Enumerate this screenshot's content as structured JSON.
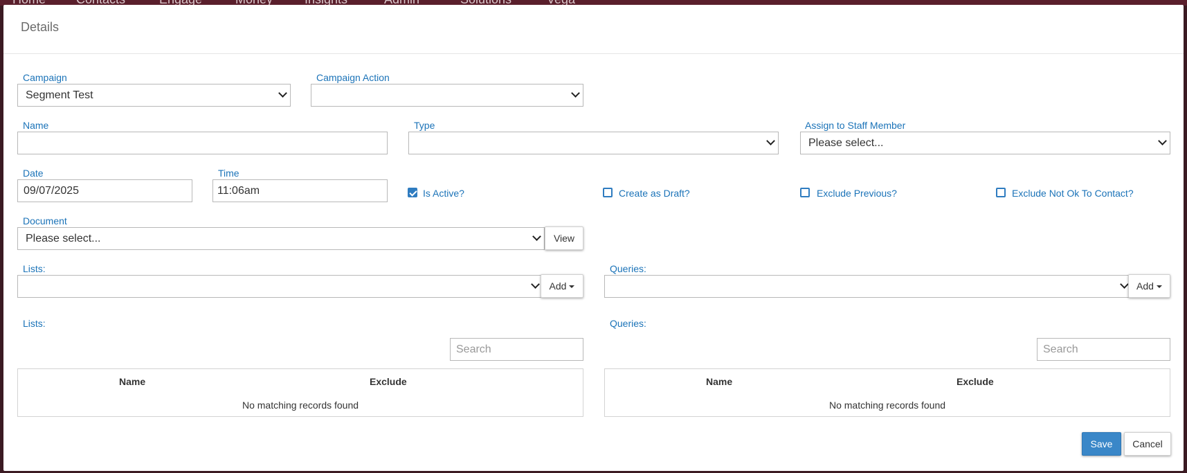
{
  "background_nav": [
    "Home",
    "Contacts",
    "Engage",
    "Money",
    "Insights",
    "Admin",
    "Solutions",
    "Vega"
  ],
  "modal": {
    "title": "Details",
    "campaign": {
      "label": "Campaign",
      "value": "Segment Test"
    },
    "campaign_action": {
      "label": "Campaign Action",
      "value": ""
    },
    "name": {
      "label": "Name",
      "value": ""
    },
    "type": {
      "label": "Type",
      "value": ""
    },
    "assign": {
      "label": "Assign to Staff Member",
      "value": "Please select..."
    },
    "date": {
      "label": "Date",
      "value": "09/07/2025"
    },
    "time": {
      "label": "Time",
      "value": "11:06am"
    },
    "checkboxes": [
      {
        "label": "Is Active?",
        "checked": true
      },
      {
        "label": "Create as Draft?",
        "checked": false
      },
      {
        "label": "Exclude Previous?",
        "checked": false
      },
      {
        "label": "Exclude Not Ok To Contact?",
        "checked": false
      }
    ],
    "document": {
      "label": "Document",
      "value": "Please select...",
      "view_button": "View"
    },
    "lists_select": {
      "label": "Lists:",
      "value": "",
      "add_button": "Add"
    },
    "queries_select": {
      "label": "Queries:",
      "value": "",
      "add_button": "Add"
    },
    "lists_table": {
      "label": "Lists:",
      "search_placeholder": "Search",
      "columns": [
        "Name",
        "Exclude"
      ],
      "empty_text": "No matching records found"
    },
    "queries_table": {
      "label": "Queries:",
      "search_placeholder": "Search",
      "columns": [
        "Name",
        "Exclude"
      ],
      "empty_text": "No matching records found"
    },
    "save_button": "Save",
    "cancel_button": "Cancel"
  },
  "colors": {
    "label_blue": "#1b73b8",
    "save_blue": "#3a87c8",
    "checkbox_blue": "#2f7cc0"
  }
}
